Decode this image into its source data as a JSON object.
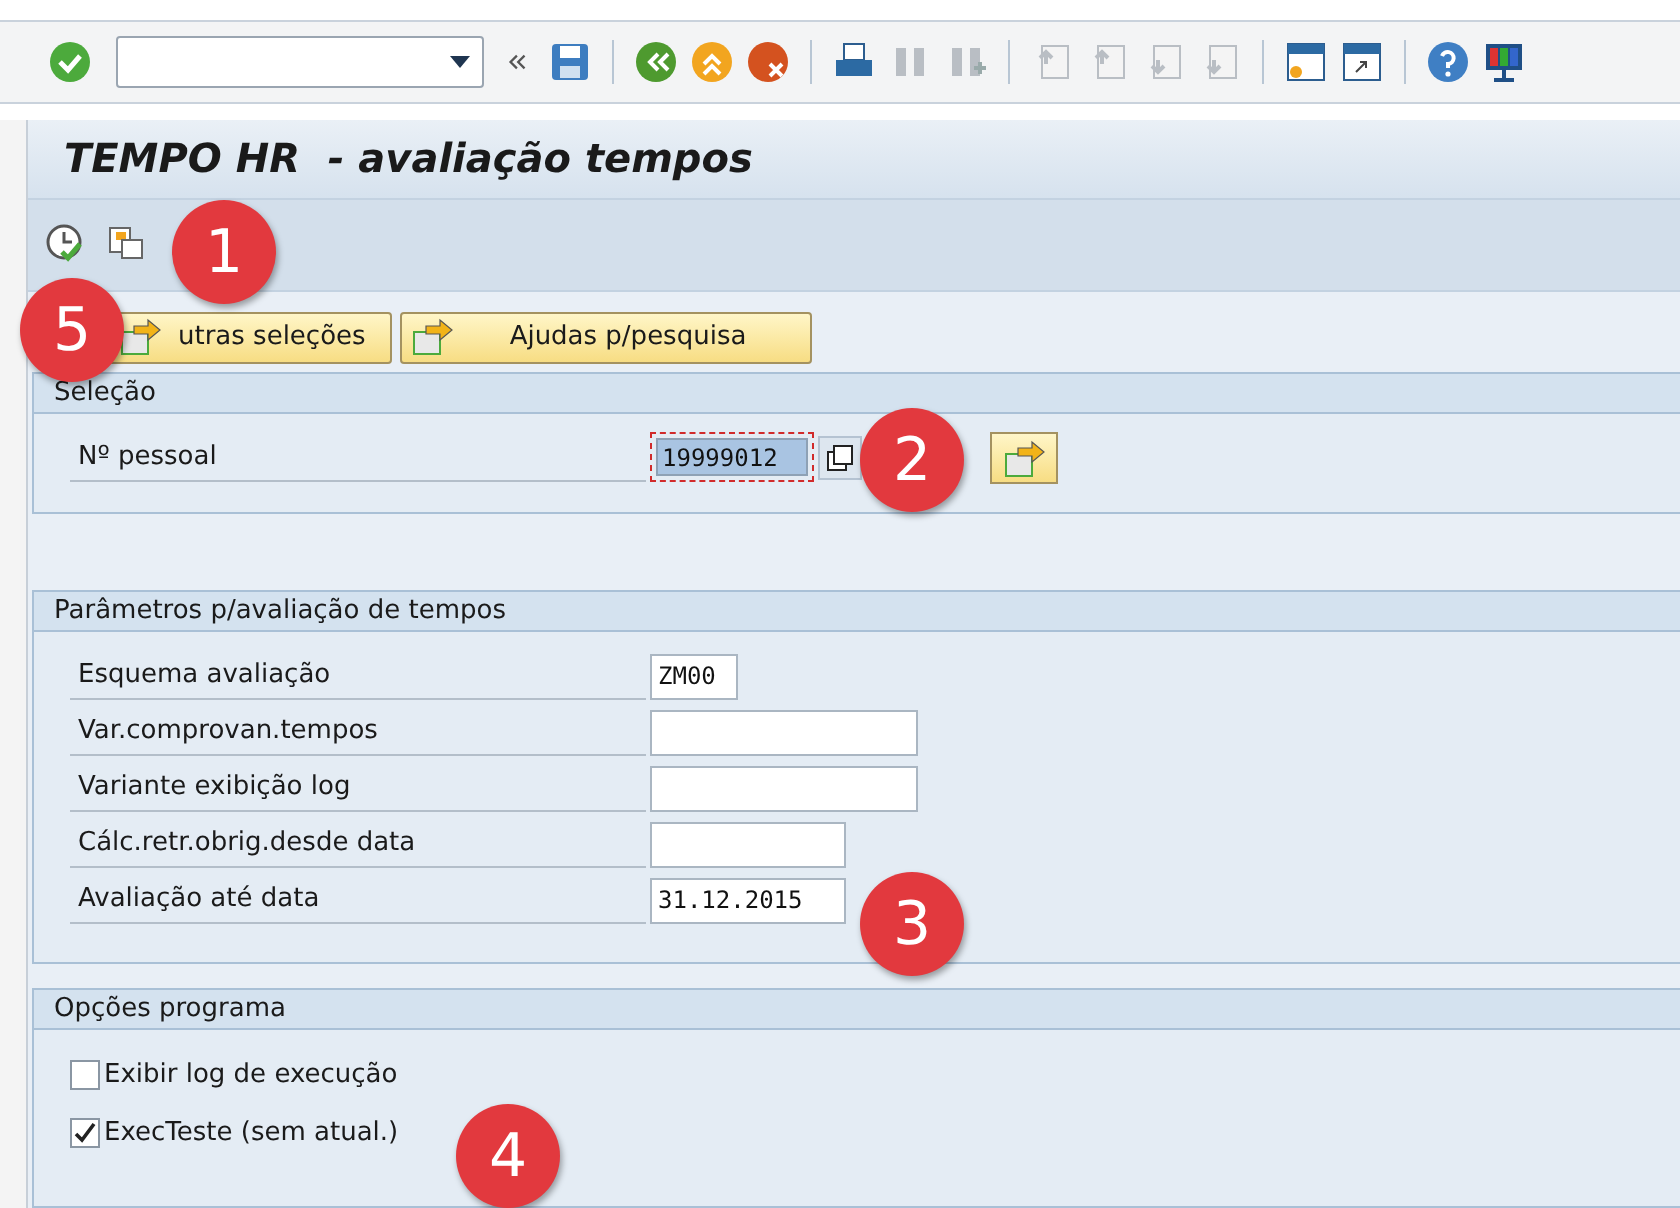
{
  "title": "TEMPO HR  - avaliação tempos",
  "action_buttons": [
    {
      "label": "utras seleções"
    },
    {
      "label": "Ajudas p/pesquisa"
    }
  ],
  "groups": [
    {
      "title": "Seleção",
      "fields": [
        {
          "label": "Nº pessoal",
          "value": "19999012",
          "kind": "selection"
        }
      ]
    },
    {
      "title": "Parâmetros p/avaliação de tempos",
      "fields": [
        {
          "label": "Esquema avaliação",
          "value": "ZM00",
          "kind": "code"
        },
        {
          "label": "Var.comprovan.tempos",
          "kind": "text"
        },
        {
          "label": "Variante exibição log",
          "kind": "text"
        },
        {
          "label": "Cálc.retr.obrig.desde data",
          "kind": "date"
        },
        {
          "label": "Avaliação até data",
          "value": "31.12.2015",
          "kind": "date"
        }
      ]
    },
    {
      "title": "Opções programa",
      "checkboxes": [
        {
          "label": "Exibir log de execução",
          "checked": false
        },
        {
          "label": "ExecTeste (sem atual.)",
          "checked": true
        }
      ]
    }
  ],
  "annotations": [
    {
      "label": "1"
    },
    {
      "label": "2"
    },
    {
      "label": "3"
    },
    {
      "label": "4"
    },
    {
      "label": "5"
    }
  ]
}
